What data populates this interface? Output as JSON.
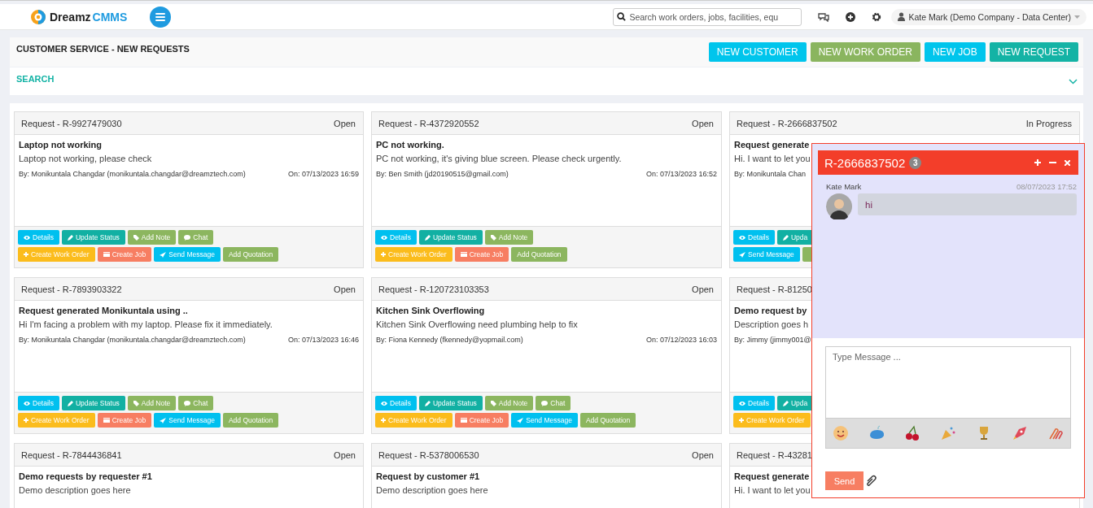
{
  "topbar": {
    "brand_part1": "Dreamz",
    "brand_part2": "CMMS",
    "search": {
      "placeholder": "Search work orders, jobs, facilities, equ"
    },
    "user": "Kate Mark (Demo Company - Data Center)"
  },
  "page": {
    "title": "CUSTOMER SERVICE - NEW REQUESTS",
    "actions": [
      {
        "label": "NEW CUSTOMER",
        "kind": "customer"
      },
      {
        "label": "NEW WORK ORDER",
        "kind": "work_order"
      },
      {
        "label": "NEW JOB",
        "kind": "job"
      },
      {
        "label": "NEW REQUEST",
        "kind": "request"
      }
    ]
  },
  "search_panel": {
    "label": "SEARCH",
    "expanded": false
  },
  "cards": [
    {
      "header": "Request - R-9927479030",
      "status": "Open",
      "title": "Laptop not working",
      "description": "Laptop not working, please check",
      "by": "By: Monikuntala Changdar (monikuntala.changdar@dreamztech.com)",
      "on": "On: 07/13/2023 16:59",
      "buttons": [
        [
          {
            "kind": "details",
            "label": "Details"
          },
          {
            "kind": "update",
            "label": "Update Status"
          },
          {
            "kind": "note",
            "label": "Add Note"
          },
          {
            "kind": "chat",
            "label": "Chat"
          }
        ],
        [
          {
            "kind": "work_order",
            "label": "Create Work Order"
          },
          {
            "kind": "job",
            "label": "Create Job"
          },
          {
            "kind": "message",
            "label": "Send Message"
          },
          {
            "kind": "quotation",
            "label": "Add Quotation"
          }
        ]
      ]
    },
    {
      "header": "Request - R-4372920552",
      "status": "Open",
      "title": "PC not working.",
      "description": "PC not working, it's giving blue screen. Please check urgently.",
      "by": "By: Ben Smith (jd20190515@gmail.com)",
      "on": "On: 07/13/2023 16:52",
      "buttons": [
        [
          {
            "kind": "details",
            "label": "Details"
          },
          {
            "kind": "update",
            "label": "Update Status"
          },
          {
            "kind": "note",
            "label": "Add Note"
          }
        ],
        [
          {
            "kind": "work_order",
            "label": "Create Work Order"
          },
          {
            "kind": "job",
            "label": "Create Job"
          },
          {
            "kind": "quotation",
            "label": "Add Quotation"
          }
        ]
      ]
    },
    {
      "header": "Request - R-2666837502",
      "status": "In Progress",
      "title": "Request generate",
      "description": "Hi. I want to let you",
      "by": "By: Monikuntala Chan",
      "buttons": [
        [
          {
            "kind": "details",
            "label": "Details"
          },
          {
            "kind": "update",
            "label": "Upda"
          }
        ],
        [
          {
            "kind": "message",
            "label": "Send Message"
          },
          {
            "kind": "quotation"
          }
        ]
      ]
    },
    {
      "header": "Request - R-7893903322",
      "status": "Open",
      "title": "Request generated Monikuntala using ..",
      "description": "Hi I'm facing a problem with my laptop. Please fix it immediately.",
      "by": "By: Monikuntala Changdar (monikuntala.changdar@dreamztech.com)",
      "on": "On: 07/13/2023 16:46",
      "buttons": [
        [
          {
            "kind": "details",
            "label": "Details"
          },
          {
            "kind": "update",
            "label": "Update Status"
          },
          {
            "kind": "note",
            "label": "Add Note"
          },
          {
            "kind": "chat",
            "label": "Chat"
          }
        ],
        [
          {
            "kind": "work_order",
            "label": "Create Work Order"
          },
          {
            "kind": "job",
            "label": "Create Job"
          },
          {
            "kind": "message",
            "label": "Send Message"
          },
          {
            "kind": "quotation",
            "label": "Add Quotation"
          }
        ]
      ]
    },
    {
      "header": "Request - R-120723103353",
      "status": "Open",
      "title": "Kitchen Sink Overflowing",
      "description": "Kitchen Sink Overflowing need plumbing help to fix",
      "by": "By: Fiona Kennedy (fkennedy@yopmail.com)",
      "on": "On: 07/12/2023 16:03",
      "buttons": [
        [
          {
            "kind": "details",
            "label": "Details"
          },
          {
            "kind": "update",
            "label": "Update Status"
          },
          {
            "kind": "note",
            "label": "Add Note"
          },
          {
            "kind": "chat",
            "label": "Chat"
          }
        ],
        [
          {
            "kind": "work_order",
            "label": "Create Work Order"
          },
          {
            "kind": "job",
            "label": "Create Job"
          },
          {
            "kind": "message",
            "label": "Send Message"
          },
          {
            "kind": "quotation",
            "label": "Add Quotation"
          }
        ]
      ]
    },
    {
      "header": "Request - R-81250",
      "title": "Demo request by",
      "description": "Description goes h",
      "by": "By: Jimmy (jimmy001@",
      "buttons": [
        [
          {
            "kind": "details",
            "label": "Details"
          },
          {
            "kind": "update",
            "label": "Upda"
          }
        ],
        [
          {
            "kind": "work_order",
            "label": "Create Work Order"
          }
        ]
      ]
    },
    {
      "header": "Request - R-7844436841",
      "status": "Open",
      "title": "Demo requests by requester #1",
      "description": "Demo description goes here"
    },
    {
      "header": "Request - R-5378006530",
      "status": "Open",
      "title": "Request by customer #1",
      "description": "Demo description goes here"
    },
    {
      "header": "Request - R-43281",
      "title": "Request generate",
      "description": "Hi. I want to let you"
    }
  ],
  "chat": {
    "title": "R-2666837502",
    "badge": "3",
    "messages": [
      {
        "sender": "Kate Mark",
        "time": "08/07/2023 17:52",
        "text": "hi"
      }
    ],
    "input": {
      "placeholder": "Type Message ..."
    },
    "send": "Send"
  }
}
